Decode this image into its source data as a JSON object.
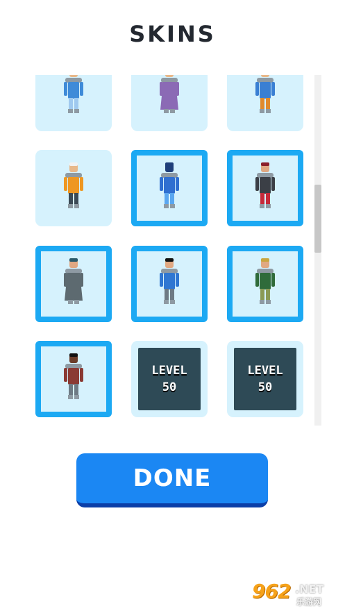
{
  "header": {
    "title": "SKINS"
  },
  "skins": [
    {
      "state": "owned",
      "outfit": "#3f8bd8",
      "accent": "#9fc9ef",
      "skin": "#e8b88a",
      "hair": "#1d2a4a",
      "robe": false
    },
    {
      "state": "owned",
      "outfit": "#8b6ab5",
      "accent": "#b59bd6",
      "skin": "#e8b88a",
      "hair": "#6b4a8a",
      "robe": true
    },
    {
      "state": "owned",
      "outfit": "#3a7fd3",
      "accent": "#e08a2c",
      "skin": "#e8b88a",
      "hair": "#2a2a2a",
      "robe": false
    },
    {
      "state": "owned",
      "outfit": "#ee9722",
      "accent": "#3b4a55",
      "skin": "#e8b88a",
      "hair": "#f2f2f2",
      "robe": false
    },
    {
      "state": "selected",
      "outfit": "#2f6fd0",
      "accent": "#5aa7f0",
      "skin": "#1f3f7a",
      "hair": "#1f3f7a",
      "robe": false
    },
    {
      "state": "selected",
      "outfit": "#3b3f46",
      "accent": "#c62a3a",
      "skin": "#e0a882",
      "hair": "#8a1f2a",
      "robe": false
    },
    {
      "state": "selected",
      "outfit": "#5d6a70",
      "accent": "#d6434a",
      "skin": "#e0a882",
      "hair": "#2a5a6a",
      "robe": true
    },
    {
      "state": "selected",
      "outfit": "#2f77d2",
      "accent": "#6d7a84",
      "skin": "#e0a882",
      "hair": "#111111",
      "robe": false
    },
    {
      "state": "selected",
      "outfit": "#2f6b3a",
      "accent": "#8a9a56",
      "skin": "#e0a882",
      "hair": "#c9a640",
      "robe": false
    },
    {
      "state": "selected",
      "outfit": "#8a3a34",
      "accent": "#6d7a84",
      "skin": "#6b3d2a",
      "hair": "#111111",
      "robe": false
    },
    {
      "state": "locked",
      "lock_line1": "LEVEL",
      "lock_line2": "50"
    },
    {
      "state": "locked",
      "lock_line1": "LEVEL",
      "lock_line2": "50"
    }
  ],
  "footer": {
    "done_label": "DONE"
  },
  "watermark": {
    "logo": "962",
    "suffix": ".NET",
    "cn": "乐游网"
  }
}
